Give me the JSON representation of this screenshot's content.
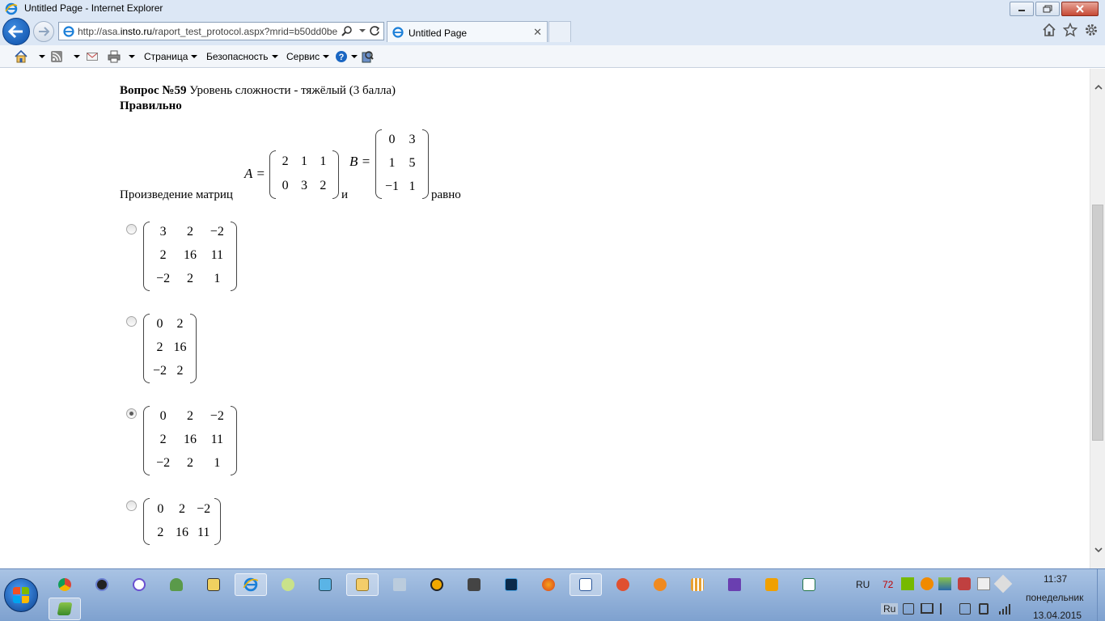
{
  "window": {
    "title": "Untitled Page - Internet Explorer"
  },
  "navigation": {
    "url_prefix": "http://asa.",
    "url_domain": "insto.ru",
    "url_suffix": "/raport_test_protocol.aspx?mrid=b50dd0be",
    "tab_label": "Untitled Page"
  },
  "commandbar": {
    "items": [
      "Страница",
      "Безопасность",
      "Сервис"
    ]
  },
  "question": {
    "number": "Вопрос №59",
    "level": " Уровень сложности - тяжёлый (3 балла)",
    "status": "Правильно",
    "prompt": "Произведение матриц",
    "and_word": "и",
    "equals_word": "равно",
    "matrix_a_label": "A =",
    "matrix_b_label": "B =",
    "matrix_a": [
      [
        "2",
        "1",
        "1"
      ],
      [
        "0",
        "3",
        "2"
      ]
    ],
    "matrix_b": [
      [
        "0",
        "3"
      ],
      [
        "1",
        "5"
      ],
      [
        "−1",
        "1"
      ]
    ]
  },
  "options": [
    {
      "checked": false,
      "rows": [
        [
          "3",
          "2",
          "−2"
        ],
        [
          "2",
          "16",
          "11"
        ],
        [
          "−2",
          "2",
          "1"
        ]
      ]
    },
    {
      "checked": false,
      "rows": [
        [
          "0",
          "2"
        ],
        [
          "2",
          "16"
        ],
        [
          "−2",
          "2"
        ]
      ]
    },
    {
      "checked": true,
      "rows": [
        [
          "0",
          "2",
          "−2"
        ],
        [
          "2",
          "16",
          "11"
        ],
        [
          "−2",
          "2",
          "1"
        ]
      ]
    },
    {
      "checked": false,
      "rows": [
        [
          "0",
          "2",
          "−2"
        ],
        [
          "2",
          "16",
          "11"
        ]
      ]
    }
  ],
  "taskbar": {
    "lang_top": "RU",
    "lang_bottom": "Ru",
    "badge": "72",
    "time": "11:37",
    "weekday": "понедельник",
    "date": "13.04.2015"
  },
  "colors": {
    "chrome_bg": "#dce7f5",
    "taskbar": "#8fb0da",
    "accent_blue": "#1a66c2"
  }
}
